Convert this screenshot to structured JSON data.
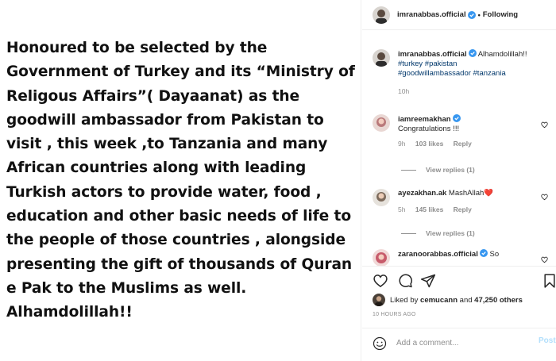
{
  "post": {
    "text": "Honoured to be selected by the Government of Turkey and its “Ministry of Religous Affairs”( Dayaanat) as the goodwill ambassador from Pakistan to visit , this week ,to Tanzania and many African countries along with leading Turkish actors to provide water, food , education and other basic needs of life to the people of those countries , alongside presenting the gift of thousands of Quran e Pak to the Muslims as well. Alhamdolillah!!"
  },
  "header": {
    "username": "imranabbas.official",
    "separator": "•",
    "follow_label": "Following"
  },
  "caption": {
    "username": "imranabbas.official",
    "text": "Alhamdolillah!!",
    "hashtags_line1": "#turkey #pakistan",
    "hashtags_line2": "#goodwillambassador #tanzania",
    "time": "10h"
  },
  "comments": [
    {
      "username": "iamreemakhan",
      "text": "Congratulations !!!",
      "time": "9h",
      "likes": "103 likes",
      "reply": "Reply",
      "view_replies": "View replies (1)"
    },
    {
      "username": "ayezakhan.ak",
      "text": "MashAllah❤️",
      "time": "5h",
      "likes": "145 likes",
      "reply": "Reply",
      "view_replies": "View replies (1)"
    },
    {
      "username": "zaranoorabbas.official",
      "text": "So"
    }
  ],
  "likes": {
    "prefix": "Liked by",
    "user": "cemucann",
    "and": "and",
    "others": "47,250 others"
  },
  "time_ago": "10 HOURS AGO",
  "comment_box": {
    "placeholder": "Add a comment...",
    "post_label": "Post"
  },
  "icons": {
    "verified": "verified-badge-icon",
    "like": "heart-icon",
    "comment": "comment-icon",
    "share": "share-icon",
    "save": "bookmark-icon",
    "emoji": "emoji-icon"
  },
  "colors": {
    "verified_blue": "#3897f0",
    "hashtag": "#00376b",
    "muted": "#8e8e8e",
    "post_disabled": "#b2dffc"
  }
}
